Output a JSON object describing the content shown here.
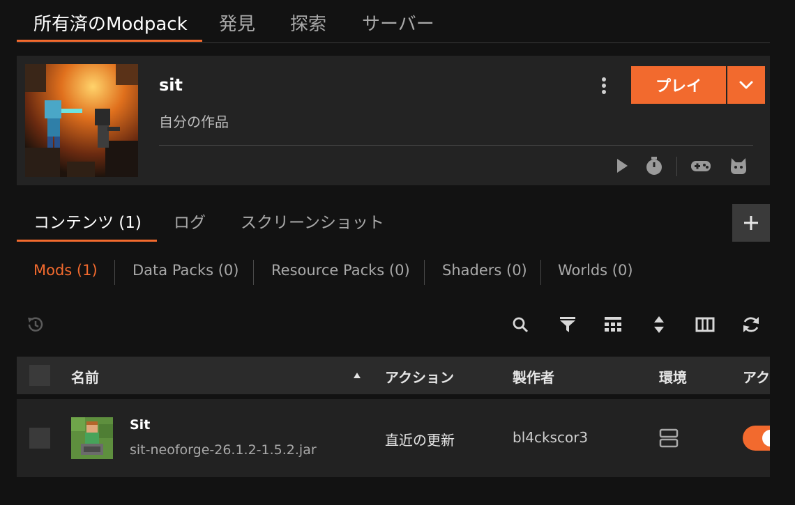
{
  "top_tabs": [
    {
      "label": "所有済のModpack"
    },
    {
      "label": "発見"
    },
    {
      "label": "探索"
    },
    {
      "label": "サーバー"
    }
  ],
  "pack": {
    "name": "sit",
    "author": "自分の作品",
    "play_label": "プレイ",
    "quick_actions": [
      "play-icon",
      "timer-icon",
      "gamepad-icon",
      "cat-icon"
    ]
  },
  "content_tabs": [
    {
      "label": "コンテンツ (1)"
    },
    {
      "label": "ログ"
    },
    {
      "label": "スクリーンショット"
    }
  ],
  "sub_tabs": [
    {
      "label": "Mods (1)"
    },
    {
      "label": "Data Packs (0)"
    },
    {
      "label": "Resource Packs (0)"
    },
    {
      "label": "Shaders (0)"
    },
    {
      "label": "Worlds (0)"
    }
  ],
  "toolbar": [
    "history-icon",
    "search-icon",
    "filter-icon",
    "grid-icon",
    "sort-icon",
    "columns-icon",
    "refresh-icon"
  ],
  "table": {
    "columns": [
      "名前",
      "アクション",
      "製作者",
      "環境",
      "アク"
    ],
    "sort_column": "名前",
    "sort_direction": "ascending",
    "rows": [
      {
        "name": "Sit",
        "file": "sit-neoforge-26.1.2-1.5.2.jar",
        "action": "直近の更新",
        "author": "bl4ckscor3",
        "environment": "server-icon",
        "active": true
      }
    ]
  },
  "colors": {
    "accent": "#f26a2e",
    "background": "#121212",
    "card": "#232323"
  }
}
